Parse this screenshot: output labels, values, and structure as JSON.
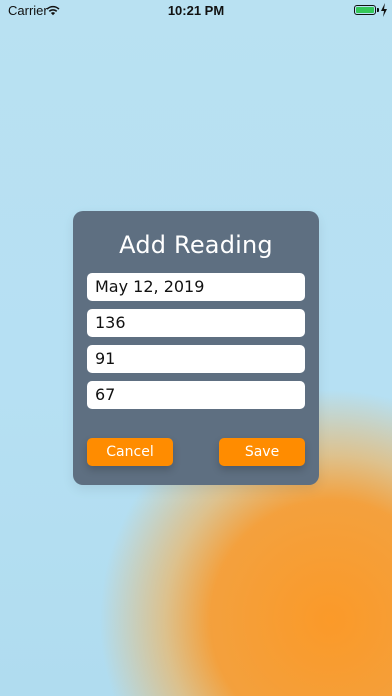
{
  "status_bar": {
    "carrier": "Carrier",
    "time": "10:21 PM",
    "icons": [
      "wifi-icon",
      "battery-icon",
      "charging-icon"
    ],
    "battery_color": "#34c759"
  },
  "modal": {
    "title": "Add Reading",
    "fields": [
      {
        "value": "May 12, 2019"
      },
      {
        "value": "136"
      },
      {
        "value": "91"
      },
      {
        "value": "67"
      }
    ],
    "cancel_label": "Cancel",
    "save_label": "Save"
  },
  "colors": {
    "background": "#b8e0f1",
    "card": "#5e6f81",
    "button": "#ff8c00",
    "glow": "#ff9a1e"
  }
}
